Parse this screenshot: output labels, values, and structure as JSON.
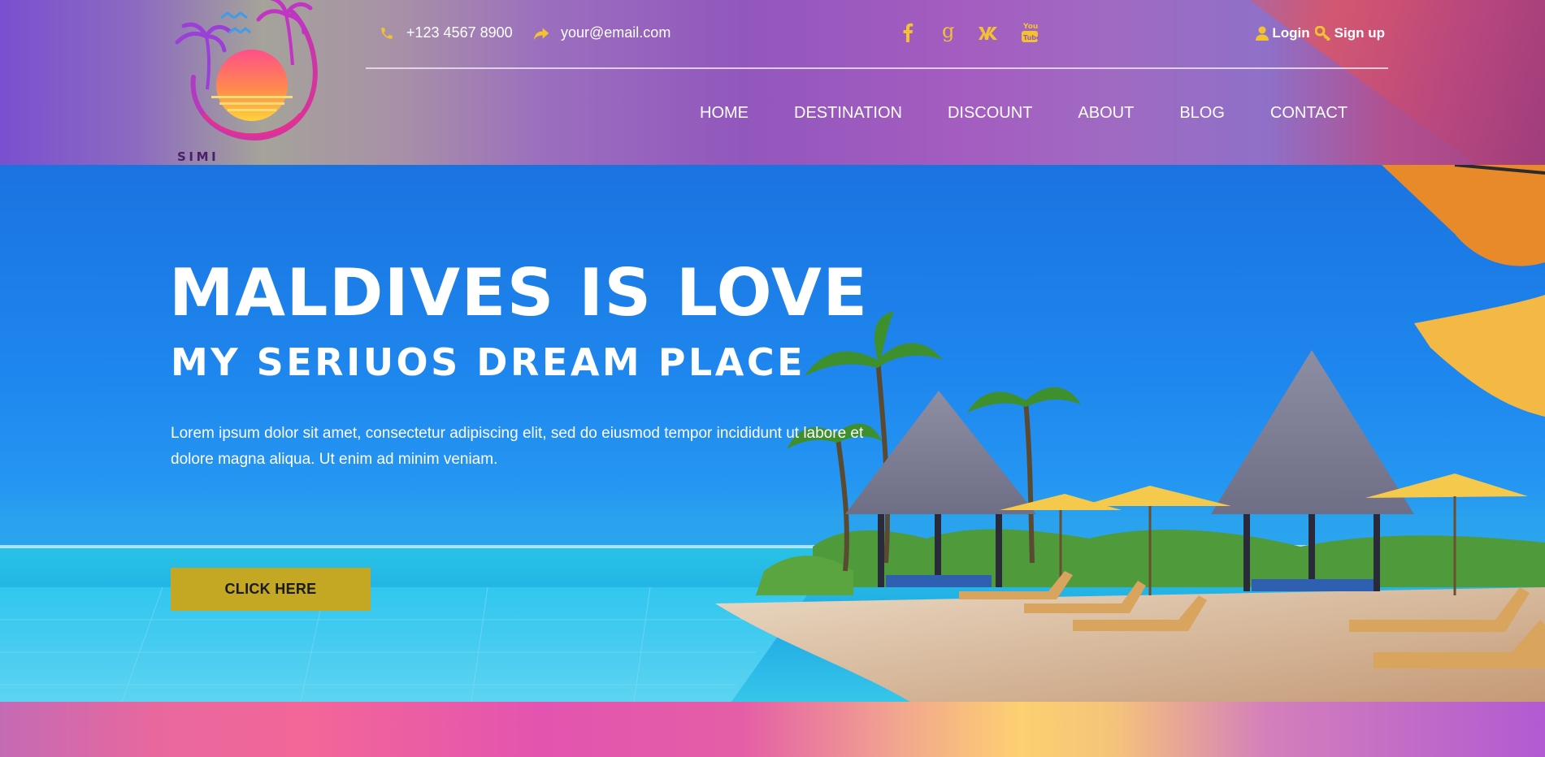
{
  "brand": {
    "name": "SIMI MALEDIVEN"
  },
  "contact": {
    "phone": "+123 4567 8900",
    "email": "your@email.com"
  },
  "social": [
    {
      "icon": "facebook-icon",
      "glyph": "f"
    },
    {
      "icon": "google-icon",
      "glyph": "g"
    },
    {
      "icon": "vk-icon",
      "glyph": "vk"
    },
    {
      "icon": "youtube-icon",
      "glyph": "You Tube"
    }
  ],
  "auth": {
    "login": "Login",
    "signup": "Sign up"
  },
  "nav": {
    "home": "HOME",
    "destination": "DESTINATION",
    "discount": "DISCOUNT",
    "about": "ABOUT",
    "blog": "BLOG",
    "contact": "CONTACT"
  },
  "hero": {
    "title": "MALDIVES IS LOVE",
    "subtitle": "MY SERIUOS DREAM PLACE",
    "description": "Lorem ipsum dolor sit amet, consectetur adipiscing elit, sed do eiusmod tempor incididunt ut labore et dolore magna aliqua. Ut enim ad minim veniam.",
    "cta": "CLICK HERE"
  },
  "colors": {
    "accent_yellow": "#f2c230",
    "cta_gold": "#c4a722",
    "logo_text": "#4a1f6a",
    "hero_blue": "#1e86ee"
  }
}
